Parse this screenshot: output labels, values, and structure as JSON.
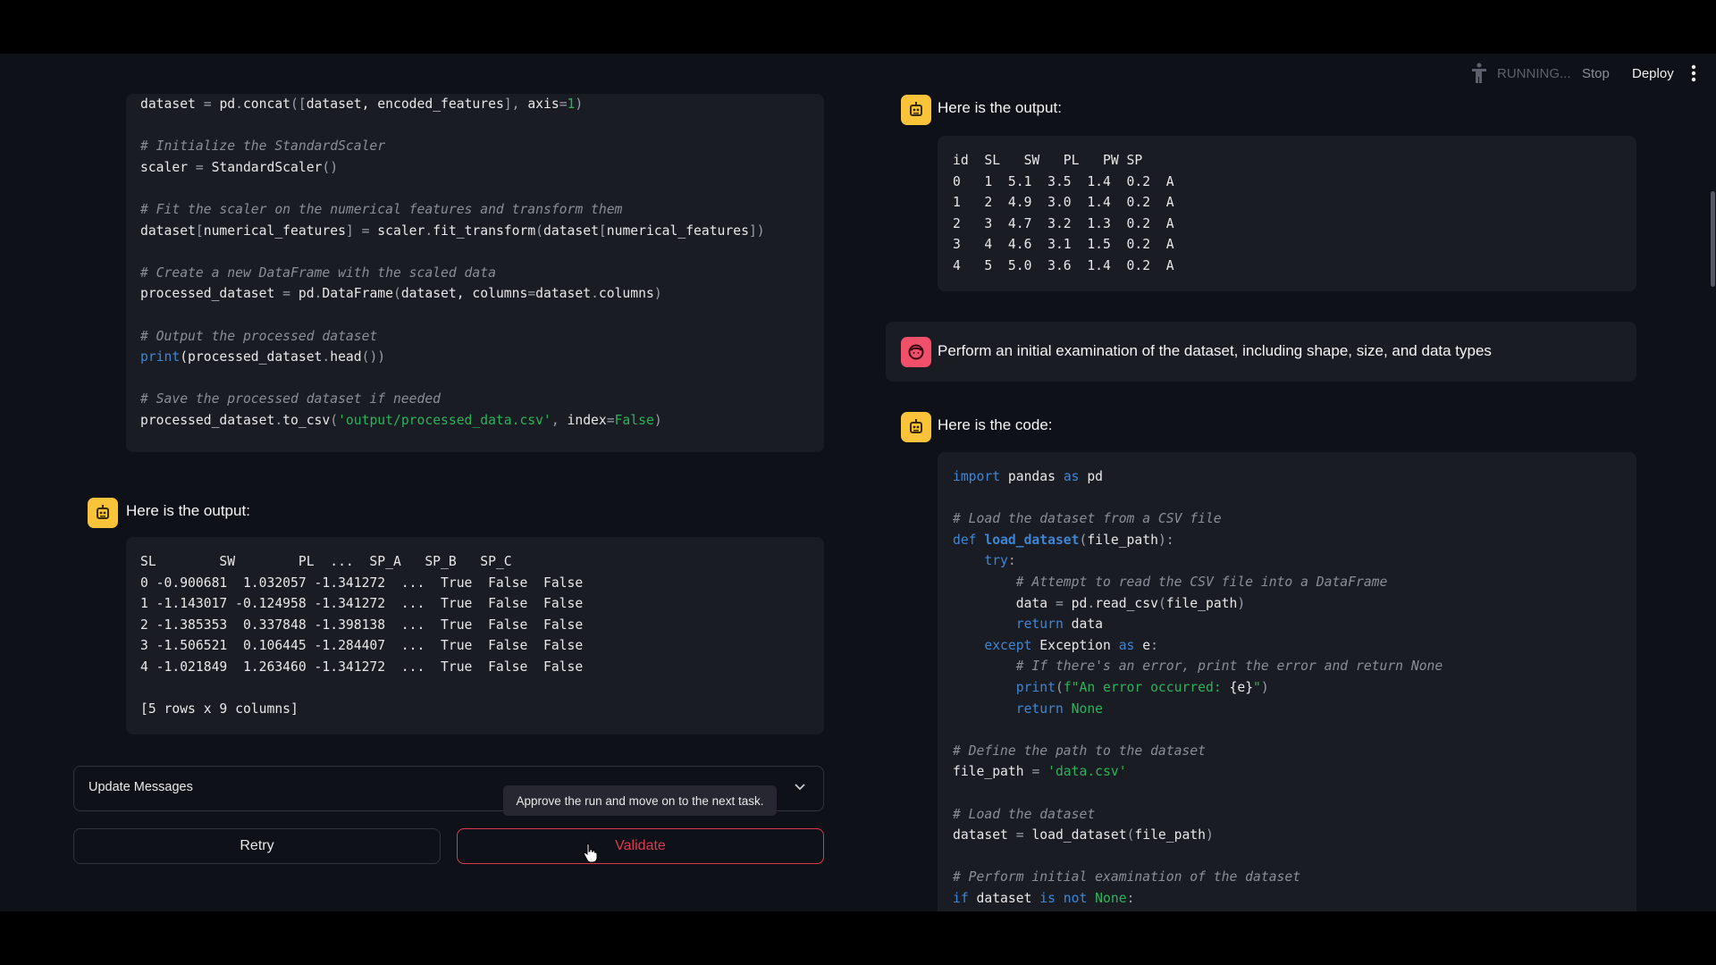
{
  "header": {
    "status": "RUNNING...",
    "stop": "Stop",
    "deploy": "Deploy",
    "icons": {
      "running": "running-man-icon",
      "menu": "kebab-menu-icon"
    }
  },
  "left": {
    "code_lines": [
      [
        [
          "dataset ",
          ""
        ],
        [
          "= ",
          "op"
        ],
        [
          "pd",
          ""
        ],
        [
          ".",
          "op"
        ],
        [
          "concat",
          ""
        ],
        [
          "([",
          "op"
        ],
        [
          "dataset, encoded_features",
          ""
        ],
        [
          "], ",
          "op"
        ],
        [
          "axis",
          ""
        ],
        [
          "=",
          "op"
        ],
        [
          "1",
          "num"
        ],
        [
          ")",
          "op"
        ]
      ],
      [],
      [
        [
          "# Initialize the StandardScaler",
          "cm"
        ]
      ],
      [
        [
          "scaler ",
          ""
        ],
        [
          "= ",
          "op"
        ],
        [
          "StandardScaler",
          ""
        ],
        [
          "()",
          "op"
        ]
      ],
      [],
      [
        [
          "# Fit the scaler on the numerical features and transform them",
          "cm"
        ]
      ],
      [
        [
          "dataset",
          ""
        ],
        [
          "[",
          "op"
        ],
        [
          "numerical_features",
          ""
        ],
        [
          "] ",
          "op"
        ],
        [
          "= ",
          "op"
        ],
        [
          "scaler",
          ""
        ],
        [
          ".",
          "op"
        ],
        [
          "fit_transform",
          ""
        ],
        [
          "(",
          "op"
        ],
        [
          "dataset",
          ""
        ],
        [
          "[",
          "op"
        ],
        [
          "numerical_features",
          ""
        ],
        [
          "])",
          "op"
        ]
      ],
      [],
      [
        [
          "# Create a new DataFrame with the scaled data",
          "cm"
        ]
      ],
      [
        [
          "processed_dataset ",
          ""
        ],
        [
          "= ",
          "op"
        ],
        [
          "pd",
          ""
        ],
        [
          ".",
          "op"
        ],
        [
          "DataFrame",
          ""
        ],
        [
          "(",
          "op"
        ],
        [
          "dataset, columns",
          ""
        ],
        [
          "=",
          "op"
        ],
        [
          "dataset",
          ""
        ],
        [
          ".",
          "op"
        ],
        [
          "columns",
          ""
        ],
        [
          ")",
          "op"
        ]
      ],
      [],
      [
        [
          "# Output the processed dataset",
          "cm"
        ]
      ],
      [
        [
          "print",
          "kw"
        ],
        [
          "(processed_dataset",
          ""
        ],
        [
          ".",
          "op"
        ],
        [
          "head",
          ""
        ],
        [
          "())",
          "op"
        ]
      ],
      [],
      [
        [
          "# Save the processed dataset if needed",
          "cm"
        ]
      ],
      [
        [
          "processed_dataset",
          ""
        ],
        [
          ".",
          "op"
        ],
        [
          "to_csv",
          ""
        ],
        [
          "(",
          "op"
        ],
        [
          "'output/processed_data.csv'",
          "st"
        ],
        [
          ", ",
          "op"
        ],
        [
          "index",
          ""
        ],
        [
          "=",
          "op"
        ],
        [
          "False",
          "num"
        ],
        [
          ")",
          "op"
        ]
      ]
    ],
    "output_label": "Here is the output:",
    "output_lines": [
      "SL        SW        PL  ...  SP_A   SP_B   SP_C",
      "0 -0.900681  1.032057 -1.341272  ...  True  False  False",
      "1 -1.143017 -0.124958 -1.341272  ...  True  False  False",
      "2 -1.385353  0.337848 -1.398138  ...  True  False  False",
      "3 -1.506521  0.106445 -1.284407  ...  True  False  False",
      "4 -1.021849  1.263460 -1.341272  ...  True  False  False",
      "",
      "[5 rows x 9 columns]"
    ],
    "expander_label": "Update Messages",
    "tooltip": "Approve the run and move on to the next task.",
    "retry": "Retry",
    "validate": "Validate"
  },
  "right": {
    "output_label": "Here is the output:",
    "output_lines": [
      "id  SL   SW   PL   PW SP",
      "0   1  5.1  3.5  1.4  0.2  A",
      "1   2  4.9  3.0  1.4  0.2  A",
      "2   3  4.7  3.2  1.3  0.2  A",
      "3   4  4.6  3.1  1.5  0.2  A",
      "4   5  5.0  3.6  1.4  0.2  A"
    ],
    "user_message": "Perform an initial examination of the dataset, including shape, size, and data types",
    "code_label": "Here is the code:",
    "code_lines": [
      [
        [
          "import",
          "kw"
        ],
        [
          " pandas ",
          ""
        ],
        [
          "as",
          "kw"
        ],
        [
          " pd",
          ""
        ]
      ],
      [],
      [
        [
          "# Load the dataset from a CSV file",
          "cm"
        ]
      ],
      [
        [
          "def ",
          "kw"
        ],
        [
          "load_dataset",
          "fn"
        ],
        [
          "(",
          "op"
        ],
        [
          "file_path",
          ""
        ],
        [
          "):",
          "op"
        ]
      ],
      [
        [
          "    try",
          "kw"
        ],
        [
          ":",
          "op"
        ]
      ],
      [
        [
          "        # Attempt to read the CSV file into a DataFrame",
          "cm"
        ]
      ],
      [
        [
          "        data ",
          ""
        ],
        [
          "= ",
          "op"
        ],
        [
          "pd",
          ""
        ],
        [
          ".",
          "op"
        ],
        [
          "read_csv",
          ""
        ],
        [
          "(",
          "op"
        ],
        [
          "file_path",
          ""
        ],
        [
          ")",
          "op"
        ]
      ],
      [
        [
          "        return",
          "kw"
        ],
        [
          " data",
          ""
        ]
      ],
      [
        [
          "    except",
          "kw"
        ],
        [
          " Exception ",
          ""
        ],
        [
          "as",
          "kw"
        ],
        [
          " e",
          ""
        ],
        [
          ":",
          "op"
        ]
      ],
      [
        [
          "        # If there's an error, print the error and return None",
          "cm"
        ]
      ],
      [
        [
          "        print",
          "kw"
        ],
        [
          "(",
          "op"
        ],
        [
          "f\"An error occurred: ",
          "st"
        ],
        [
          "{e}",
          ""
        ],
        [
          "\"",
          "st"
        ],
        [
          ")",
          "op"
        ]
      ],
      [
        [
          "        return",
          "kw"
        ],
        [
          " None",
          "num"
        ]
      ],
      [],
      [
        [
          "# Define the path to the dataset",
          "cm"
        ]
      ],
      [
        [
          "file_path ",
          ""
        ],
        [
          "= ",
          "op"
        ],
        [
          "'data.csv'",
          "st"
        ]
      ],
      [],
      [
        [
          "# Load the dataset",
          "cm"
        ]
      ],
      [
        [
          "dataset ",
          ""
        ],
        [
          "= ",
          "op"
        ],
        [
          "load_dataset",
          ""
        ],
        [
          "(",
          "op"
        ],
        [
          "file_path",
          ""
        ],
        [
          ")",
          "op"
        ]
      ],
      [],
      [
        [
          "# Perform initial examination of the dataset",
          "cm"
        ]
      ],
      [
        [
          "if",
          "kw"
        ],
        [
          " dataset ",
          ""
        ],
        [
          "is not",
          "kw"
        ],
        [
          " None",
          "num"
        ],
        [
          ":",
          "op"
        ]
      ]
    ]
  },
  "colors": {
    "background": "#0e1117",
    "code_bg": "#1a1c24",
    "bot_avatar": "#fbc33a",
    "user_avatar": "#f0506a",
    "validate": "#e0394f"
  }
}
